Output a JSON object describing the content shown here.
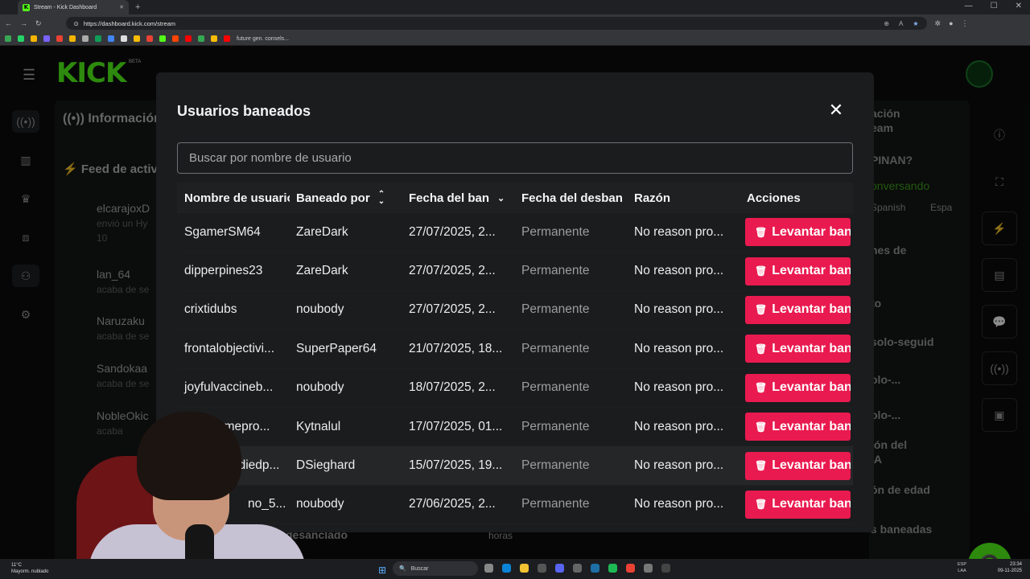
{
  "browser": {
    "tab_title": "Stream - Kick Dashboard",
    "url": "https://dashboard.kick.com/stream",
    "bookmark_label": "future gen. consels..."
  },
  "dashboard": {
    "logo": "KICK",
    "beta": "BETA",
    "panel_info": "Información",
    "panel_feed": "Feed de activ",
    "feed": [
      {
        "name": "elcarajoxD",
        "sub": "envió un Hy",
        "extra": "10"
      },
      {
        "name": "lan_64",
        "sub": "acaba de se"
      },
      {
        "name": "Naruzaku",
        "sub": "acaba de se"
      },
      {
        "name": "Sandokaa",
        "sub": "acaba de se"
      },
      {
        "name": "NobleOkic",
        "sub": "acaba"
      }
    ],
    "right": {
      "a": "ación",
      "b": "eam",
      "c": "PINAN?",
      "d": "onversando",
      "e": "Spanish",
      "f": "Espa",
      "g": "nes de",
      "h": "to",
      "i": "solo-seguid",
      "j": "olo-...",
      "k": "olo-...",
      "l": "ión del",
      "m": "IA",
      "n": "ón de edad",
      "o": "s baneadas"
    },
    "bottom_left": "desanclado",
    "bottom_mid": "horas"
  },
  "modal": {
    "title": "Usuarios baneados",
    "close_icon": "close-icon",
    "search_placeholder": "Buscar por nombre de usuario",
    "columns": [
      "Nombre de usuario",
      "Baneado por",
      "Fecha del ban",
      "Fecha del desban",
      "Razón",
      "Acciones"
    ],
    "rows": [
      {
        "user": "SgamerSM64",
        "by": "ZareDark",
        "date": "27/07/2025, 2...",
        "unban": "Permanente",
        "reason": "No reason pro...",
        "action": "Levantar ban"
      },
      {
        "user": "dipperpines23",
        "by": "ZareDark",
        "date": "27/07/2025, 2...",
        "unban": "Permanente",
        "reason": "No reason pro...",
        "action": "Levantar ban"
      },
      {
        "user": "crixtidubs",
        "by": "noubody",
        "date": "27/07/2025, 2...",
        "unban": "Permanente",
        "reason": "No reason pro...",
        "action": "Levantar ban"
      },
      {
        "user": "frontalobjectivi...",
        "by": "SuperPaper64",
        "date": "21/07/2025, 18...",
        "unban": "Permanente",
        "reason": "No reason pro...",
        "action": "Levantar ban"
      },
      {
        "user": "joyfulvaccineb...",
        "by": "noubody",
        "date": "18/07/2025, 2...",
        "unban": "Permanente",
        "reason": "No reason pro...",
        "action": "Levantar ban"
      },
      {
        "user": "omepro...",
        "by": "Kytnalul",
        "date": "17/07/2025, 01...",
        "unban": "Permanente",
        "reason": "No reason pro...",
        "action": "Levantar ban"
      },
      {
        "user": "ediedp...",
        "by": "DSieghard",
        "date": "15/07/2025, 19...",
        "unban": "Permanente",
        "reason": "No reason pro...",
        "action": "Levantar ban"
      },
      {
        "user": "no_5...",
        "by": "noubody",
        "date": "27/06/2025, 2...",
        "unban": "Permanente",
        "reason": "No reason pro...",
        "action": "Levantar ban"
      }
    ]
  },
  "taskbar": {
    "weather_temp": "11°C",
    "weather_desc": "Mayorm. nublado",
    "search": "Buscar",
    "lang1": "ESP",
    "lang2": "LAA",
    "time": "23:34",
    "date": "09-11-2025"
  },
  "colors": {
    "brand_green": "#53fc18",
    "ban_red": "#e91a4f",
    "modal_bg": "#1b1c1e"
  }
}
